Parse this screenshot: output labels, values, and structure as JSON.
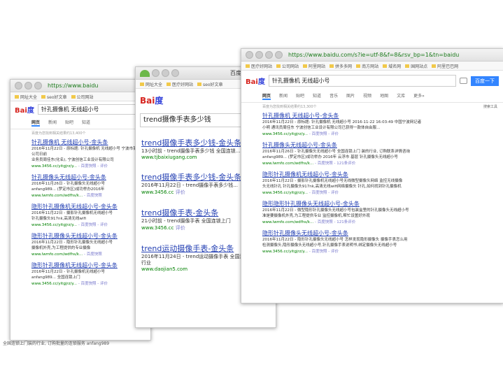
{
  "colors": {
    "title_link": "#2440b3",
    "highlight": "#d6241f",
    "url_green": "#008000",
    "button": "#3385ff"
  },
  "w1": {
    "url": "https://www.baidu",
    "bookmarks": [
      "网址大全",
      "seo好文章",
      "公司网站"
    ],
    "query": "针孔摄像机 无线超小号",
    "tabs": [
      "网页",
      "新闻",
      "贴吧",
      "知道"
    ],
    "info": "百度为您找到相关结果约13,400个",
    "results": [
      {
        "title": "针孔摄像机 无线超小号-金头条",
        "snip": "2016年11月22日 - 原标题: 针孔摄像机 无线超小号 宁波市某网络公司日前",
        "snip2": "业务员周佳东(化名), 宁波创信工业设计有限公司",
        "url": "www.3456.cc/yitgjrz/y...",
        "link": "- 百度快照 - 评价"
      },
      {
        "title": "针孔摄像头无线超小号-金头条",
        "snip": "2016年11月26日 - 针孔摄像头无线超小号",
        "snip2": "anfang989... (罗定市区)成功举办2016年",
        "url": "www.lwmfo.com/wdfhs/k...",
        "link": "- 百度快照"
      },
      {
        "title": "隐形针孔摄像机无线超小号-金头条",
        "snip": "2016年11月22日 - 摄影针孔摄像机无线超小号",
        "snip2": "针孔摄像头917nk,高清无线wifi",
        "url": "www.3456.cc/yitgjrz/y...",
        "link": "- 百度快照 - 评价"
      },
      {
        "title": "隐形针孔摄像头无线超小号-金头条",
        "snip": "2016年11月22日 - 隐形针孔摄像头无线超小号",
        "snip2": "摄像机外壳,为工程提供的专业摄像",
        "url": "www.lwmfo.com/wdfhs/k...",
        "link": "- 百度快照"
      },
      {
        "title": "隐形针孔摄像机无线超小号-金头条",
        "snip": "2016年11月22日 - 针孔摄像机无线超小号",
        "snip2": "anfang989... 全国连锁上门",
        "url": "www.3456.cc/yitgjrz/y...",
        "link": "- 百度快照 - 评价"
      }
    ],
    "footer": "全国连锁上门装的行业, 订购批量的连锁服务 anfang989"
  },
  "w2": {
    "url": "百度",
    "bookmarks": [
      "网址大全",
      "医疗好网站",
      "seo好文章"
    ],
    "query": "trend摄像手表多少钱",
    "results": [
      {
        "title": "trend摄像手表多少钱-金头条",
        "snip": "13小时前 - trend摄像手表多少钱 全国连锁...",
        "url": "www.tjbaixiugang.com",
        "link": ""
      },
      {
        "title": "trend摄像手表多少钱-金头条",
        "snip": "2016年11月22日 - trend摄像手表多少钱...",
        "url": "www.3456.cc",
        "link": "评价"
      },
      {
        "title": "trend摄像手表-金头条",
        "snip": "21小时前 - trend摄像手表 全国连锁上门",
        "url": "www.3456.cc",
        "link": "评价"
      },
      {
        "title": "trend运动摄像手表-金头条",
        "snip": "2016年11月24日 - trend运动摄像手表 全国连锁上门装的行业",
        "url": "www.daojian5.com",
        "link": ""
      }
    ]
  },
  "w3": {
    "url": "https://www.baidu.com/s?ie=utf-8&f=8&rsv_bp=1&tn=baidu",
    "bookmarks": [
      "医疗好网站",
      "公司网站",
      "阿里网站",
      "拼多多网",
      "南方网站",
      "域名网",
      "国网站点",
      "阿里巴巴网"
    ],
    "query": "针孔摄像机 无线超小号",
    "button": "百度一下",
    "tabs": [
      "网页",
      "新闻",
      "贴吧",
      "知道",
      "音乐",
      "图片",
      "视频",
      "地图",
      "文库",
      "更多»"
    ],
    "info": "百度为您找到相关结果约13,300个",
    "tool": "搜索工具",
    "results": [
      {
        "title": "针孔摄像机 无线超小号-金头条",
        "snip": "2016年11月22日 - 原标题: 针孔摄像机 无线超小号 2016-11-22 16:03:49 中国宁波网记者",
        "snip2": "小明 通讯员周佳东 宁波创信工业设计有限公司已获得一款体自由服...",
        "url": "www.3456.cc/yitgjrz/y...",
        "link": "- 百度快照 - 评价"
      },
      {
        "title": "针孔摄像头无线超小号-金头条",
        "snip": "2016年11月26日 - 针孔摄像头无线超小号 全国连锁上门 装的行业, 订购联系详情咨询",
        "snip2": "anfang989... (罗定市区)成功举办 2016年 云浮市 基层 针孔摄像头无线超小号",
        "url": "www.lwmfo.com/wdfhs/k...",
        "link": "- 百度快照 - 121条评价"
      },
      {
        "title": "隐形针孔摄像机无线超小号-金头条",
        "snip": "2016年11月22日 - 摄影针孔摄像机无线超小号无线微型摄像头网络 监控无线摄像",
        "snip2": "头无线针孔 针孔摄像头917nk,高清无线wifi网络摄像头 针孔,如何找到针孔摄像机",
        "url": "www.3456.cc/yitgjrz/y...",
        "link": "- 百度快照 - 评价"
      },
      {
        "title": "隐形隐形针孔摄像头无线超小号-金头条",
        "snip": "2016年11月22日 - 微型隐形针孔摄像头无线超小号包装盒里的针孔摄像头无线超小号",
        "snip2": "准是要摄像机外壳,为工程提供专业 监控摄像机,帮忙设置好外观",
        "url": "www.lwmfo.com/wdfhs/k...",
        "link": "- 百度快照 - 121条评价"
      },
      {
        "title": "隐形针孔摄像头无线超小号-金头条",
        "snip": "2016年11月22日 - 隐形针孔摄像头无线超小号 怎样发现隐形摄像头 摄像手表怎么用",
        "snip2": "检测摄像头,隐形摄像头无线超小号,针孔摄像手表说明书,绑定摄像头无线超小号",
        "url": "www.3456.cc/yitgjrz/y...",
        "link": "- 百度快照 - 评价"
      }
    ]
  }
}
